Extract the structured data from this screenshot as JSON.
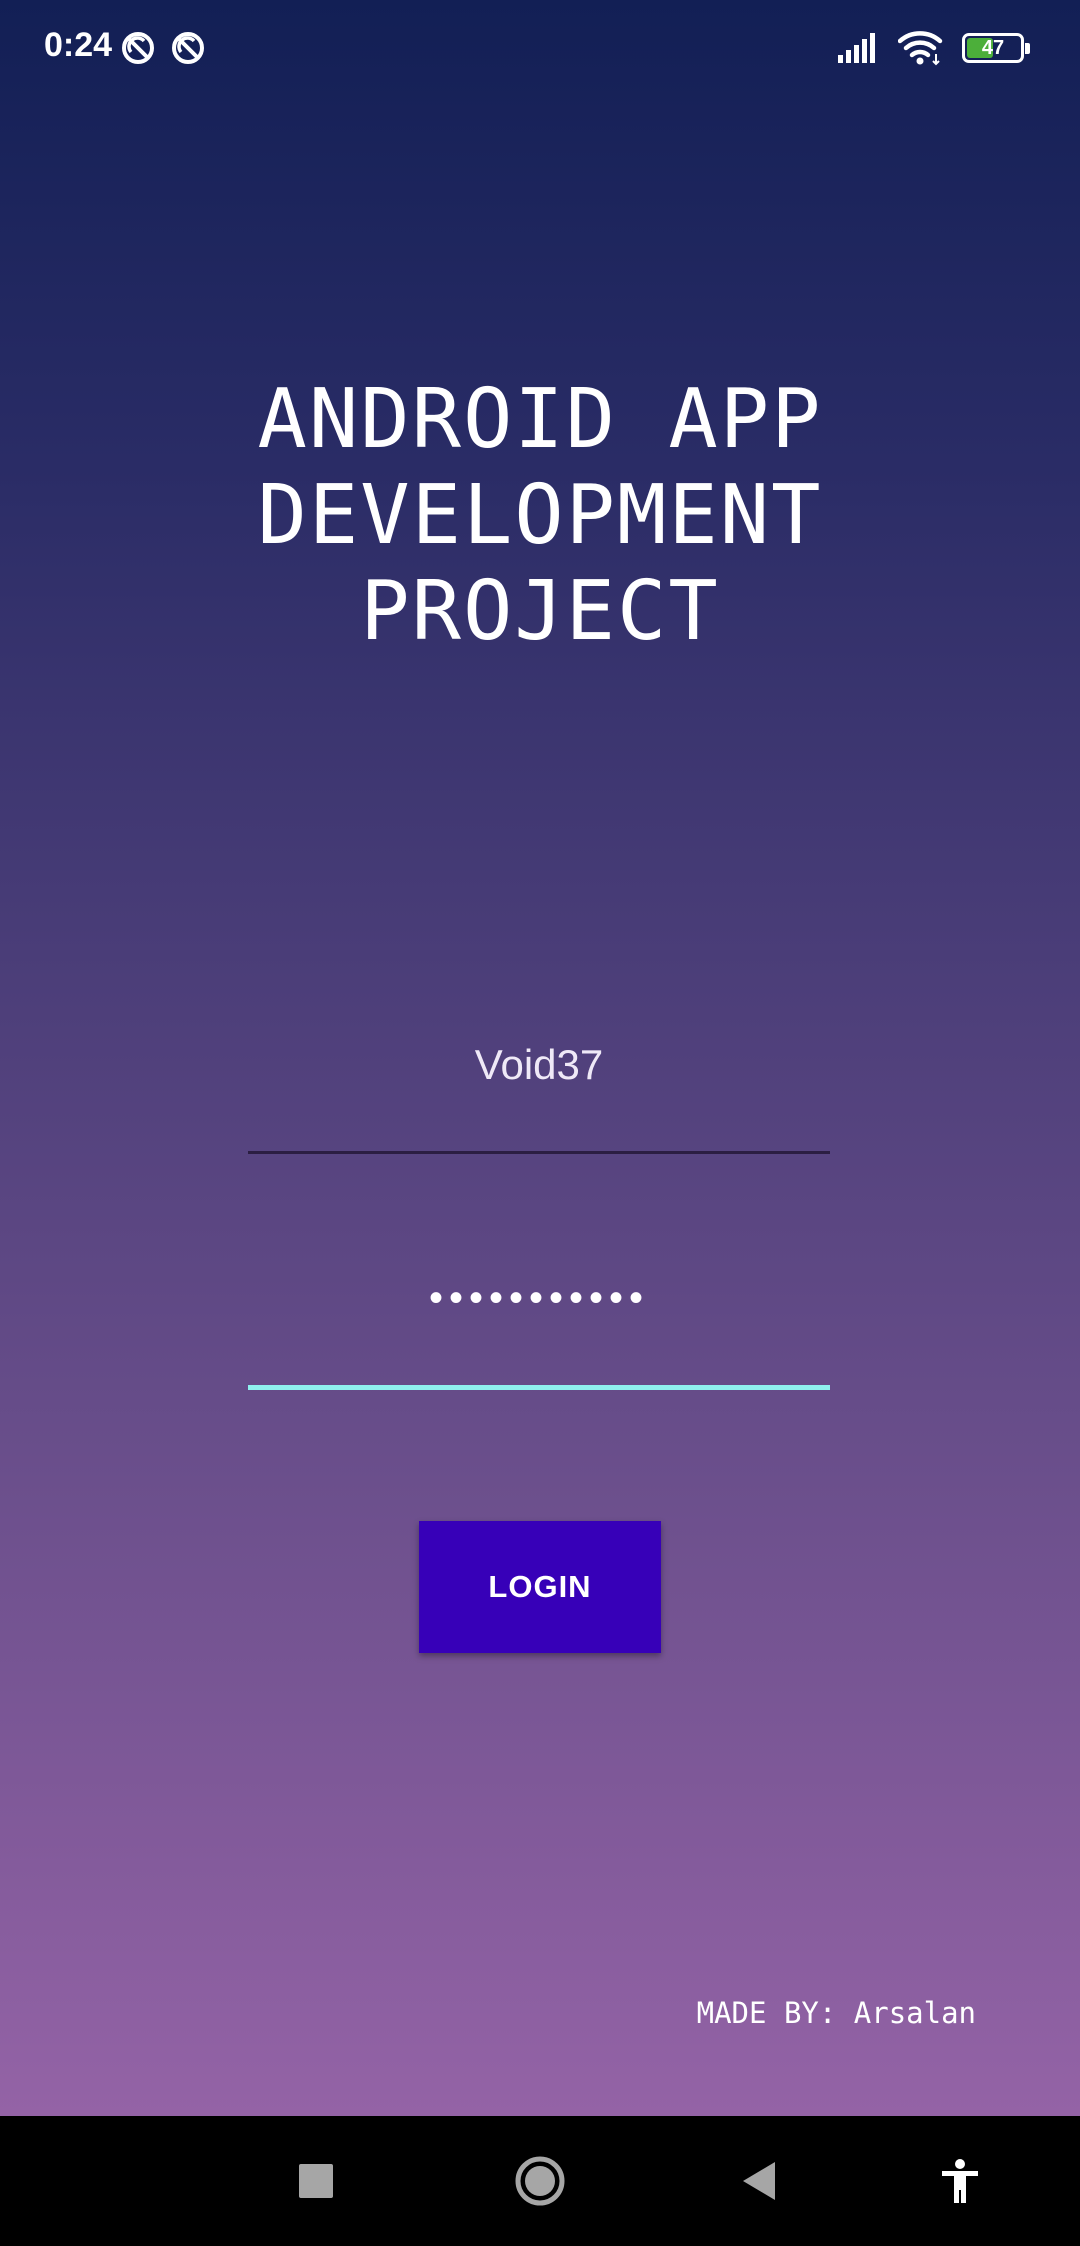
{
  "status_bar": {
    "time": "0:24",
    "battery_level": "47",
    "battery_fraction": 0.47,
    "notification_icons": [
      "sync-disabled-icon",
      "sync-disabled-icon"
    ],
    "right_icons": [
      "signal-icon",
      "wifi-icon",
      "battery-icon"
    ]
  },
  "app": {
    "title_lines": [
      "ANDROID APP",
      "DEVELOPMENT",
      "PROJECT"
    ]
  },
  "login_form": {
    "username_value": "Void37",
    "password_value": "•••••••••••",
    "login_label": "LOGIN",
    "active_underline_color": "#8ff0ee",
    "button_color": "#3700b8"
  },
  "footer": {
    "credit": "MADE BY: Arsalan"
  },
  "nav_bar": {
    "buttons": [
      "recents-icon",
      "home-icon",
      "back-icon",
      "accessibility-icon"
    ]
  }
}
